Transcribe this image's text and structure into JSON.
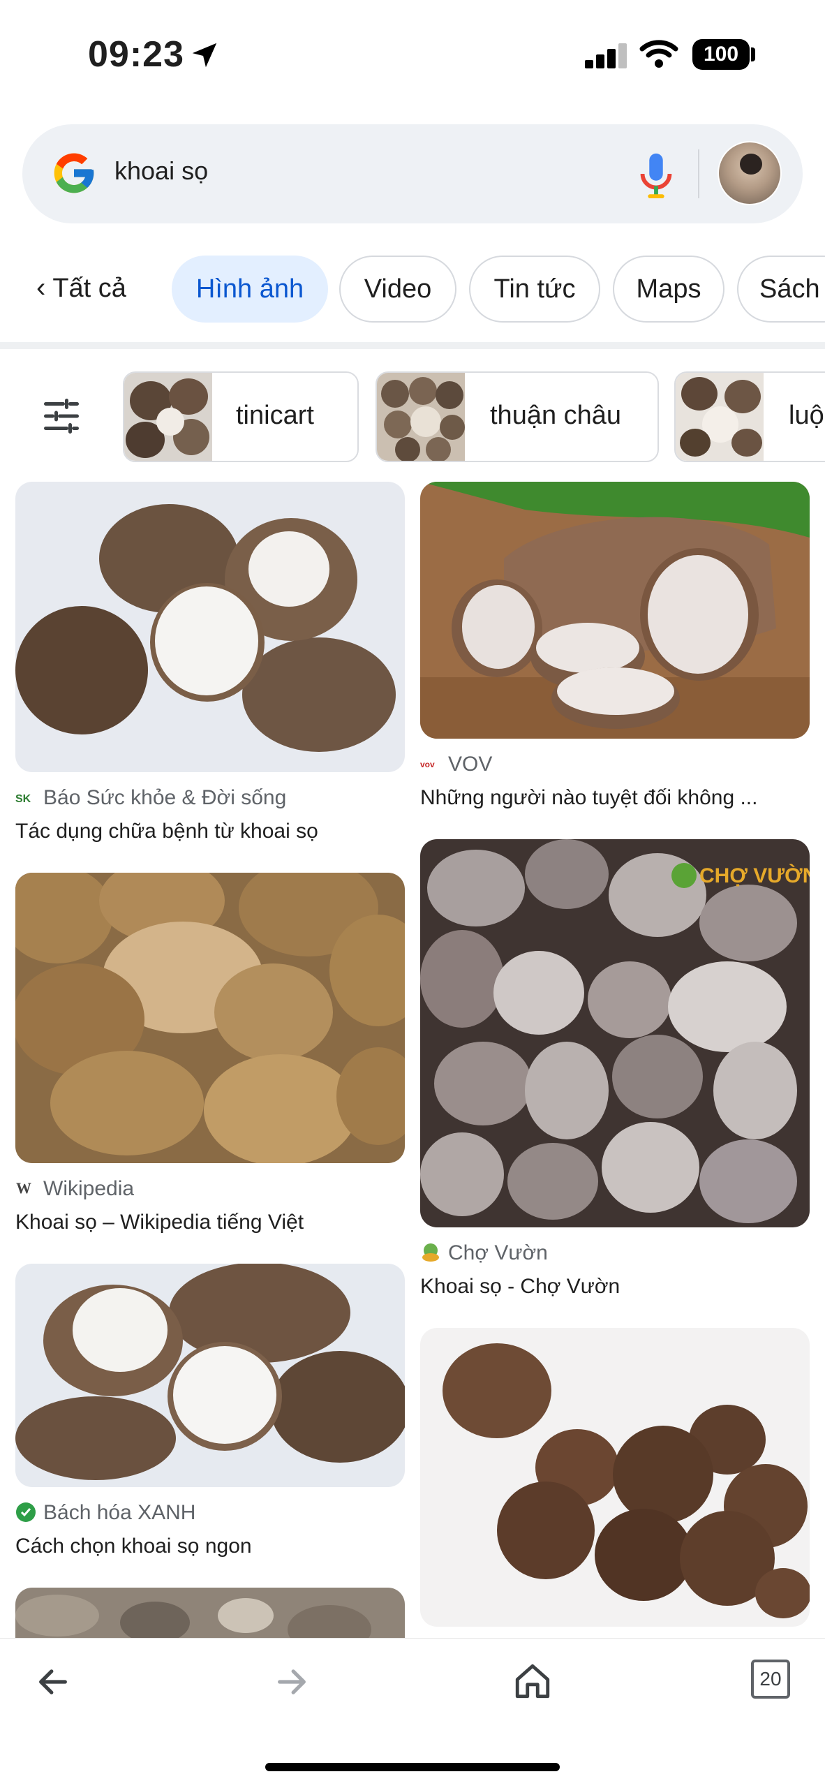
{
  "status_bar": {
    "time": "09:23",
    "battery": "100"
  },
  "search": {
    "query": "khoai sọ"
  },
  "tabs": {
    "back_label": "Tất cả",
    "items": [
      "Hình ảnh",
      "Video",
      "Tin tức",
      "Maps",
      "Sách"
    ],
    "active": "Hình ảnh"
  },
  "filters": [
    "tinicart",
    "thuận châu",
    "luộ"
  ],
  "results_left": [
    {
      "source": "Báo Sức khỏe & Đời sống",
      "title": "Tác dụng chữa bệnh từ khoai sọ"
    },
    {
      "source": "Wikipedia",
      "title": "Khoai sọ – Wikipedia tiếng Việt"
    },
    {
      "source": "Bách hóa XANH",
      "title": "Cách chọn khoai sọ ngon"
    }
  ],
  "results_right": [
    {
      "source": "VOV",
      "title": "Những người nào tuyệt đối không ..."
    },
    {
      "source": "Chợ Vườn",
      "title": "Khoai sọ - Chợ Vườn",
      "watermark": "CHỢ VƯỜN"
    }
  ],
  "bottom_bar": {
    "tab_count": "20"
  },
  "colors": {
    "accent": "#0b57d0",
    "active_tab_bg": "#e3efff",
    "search_bg": "#eef1f5"
  },
  "icons": [
    "location-arrow-icon",
    "cellular-signal-icon",
    "wifi-icon",
    "battery-icon",
    "google-logo-icon",
    "microphone-icon",
    "chevron-left-icon",
    "tune-icon",
    "back-arrow-icon",
    "forward-arrow-icon",
    "home-icon",
    "tabs-icon"
  ]
}
